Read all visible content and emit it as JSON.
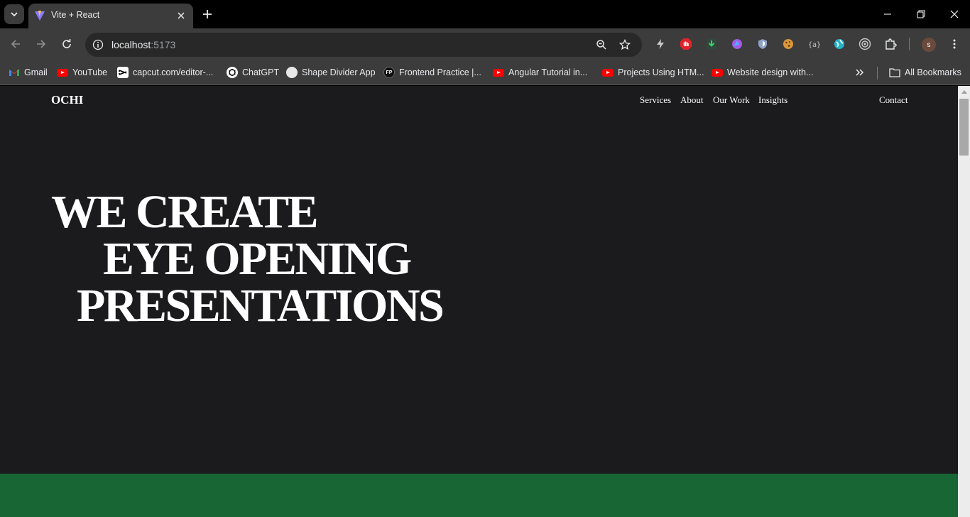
{
  "browser": {
    "tab": {
      "title": "Vite + React"
    },
    "url": {
      "host": "localhost",
      "port": ":5173"
    },
    "profile_initial": "s",
    "bookmarks": [
      {
        "label": "Gmail",
        "icon": "gmail-icon"
      },
      {
        "label": "YouTube",
        "icon": "youtube-icon"
      },
      {
        "label": "capcut.com/editor-...",
        "icon": "capcut-icon"
      },
      {
        "label": "ChatGPT",
        "icon": "chatgpt-icon"
      },
      {
        "label": "Shape Divider App",
        "icon": "shape-divider-icon"
      },
      {
        "label": "Frontend Practice |...",
        "icon": "fp-icon",
        "icon_text": "FP"
      },
      {
        "label": "Angular Tutorial in...",
        "icon": "youtube-icon"
      },
      {
        "label": "Projects Using HTM...",
        "icon": "youtube-icon"
      },
      {
        "label": "Website design with...",
        "icon": "youtube-icon"
      }
    ],
    "all_bookmarks_label": "All Bookmarks"
  },
  "page": {
    "logo": "OCHI",
    "nav": [
      "Services",
      "About",
      "Our Work",
      "Insights"
    ],
    "contact": "Contact",
    "hero": [
      "WE CREATE",
      "EYE OPENING",
      "PRESENTATIONS"
    ],
    "colors": {
      "background": "#1b1b1d",
      "band": "#186634",
      "text": "#ffffff"
    }
  }
}
